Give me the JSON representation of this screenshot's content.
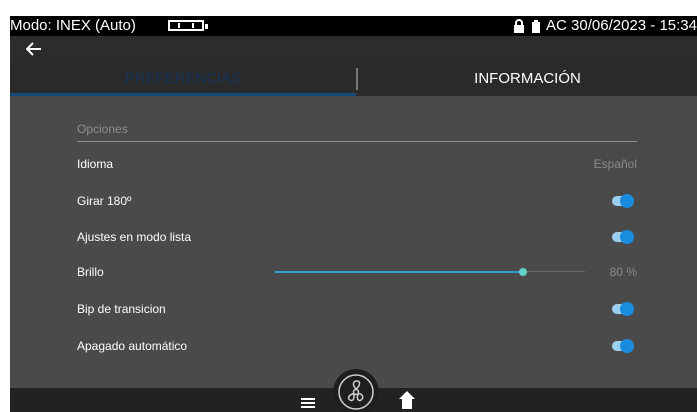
{
  "status_bar": {
    "mode": "Modo: INEX (Auto)",
    "datetime": "AC 30/06/2023 - 15:34",
    "icons": [
      "battery-icon",
      "lock-icon",
      "plug-icon"
    ]
  },
  "nav": {
    "back_icon": "arrow-left-icon"
  },
  "tabs": [
    {
      "label": "PREFERENCIAS",
      "active": true
    },
    {
      "label": "INFORMACIÓN",
      "active": false
    }
  ],
  "section": {
    "title": "Opciones"
  },
  "settings": {
    "language": {
      "label": "Idioma",
      "value": "Español"
    },
    "rotate": {
      "label": "Girar 180º",
      "enabled": true
    },
    "list_mode": {
      "label": "Ajustes en modo lista",
      "enabled": true
    },
    "brightness": {
      "label": "Brillo",
      "value_text": "80 %",
      "level_fraction": 0.8
    },
    "transition_beep": {
      "label": "Bip de transicion",
      "enabled": true
    },
    "auto_off": {
      "label": "Apagado automático",
      "enabled": true
    }
  },
  "bottom_bar": {
    "icons": [
      "menu-icon",
      "fan-icon",
      "home-icon"
    ]
  },
  "colors": {
    "toggle_on": "#1a8ce0",
    "slider_fill": "#2f9fd6",
    "slider_thumb": "#62d2c9",
    "active_tab_text": "#16345a"
  }
}
